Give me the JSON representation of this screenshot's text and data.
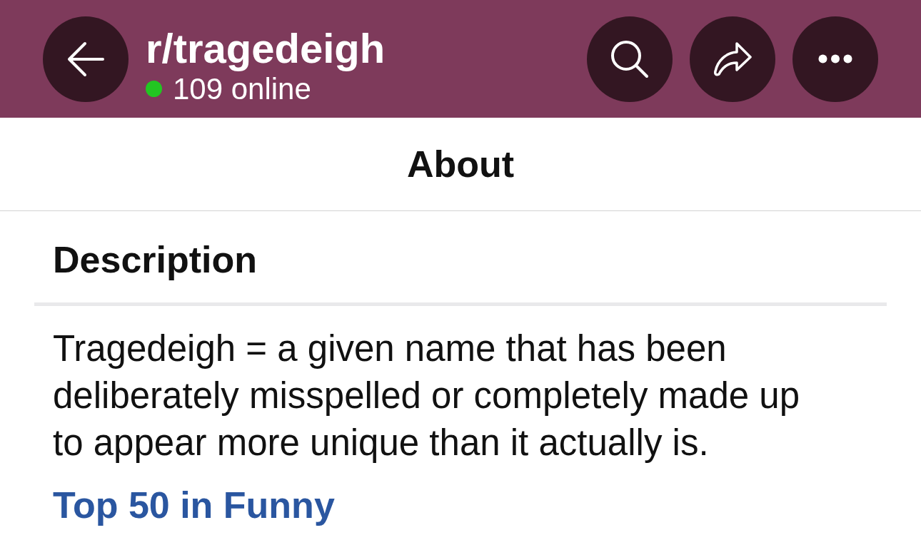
{
  "header": {
    "title": "r/tragedeigh",
    "online": "109 online"
  },
  "page_title": "About",
  "section": {
    "heading": "Description",
    "body": "Tragedeigh = a given name that has been deliberately misspelled or completely made up to appear more unique than it actually is.",
    "link": "Top 50 in Funny"
  }
}
